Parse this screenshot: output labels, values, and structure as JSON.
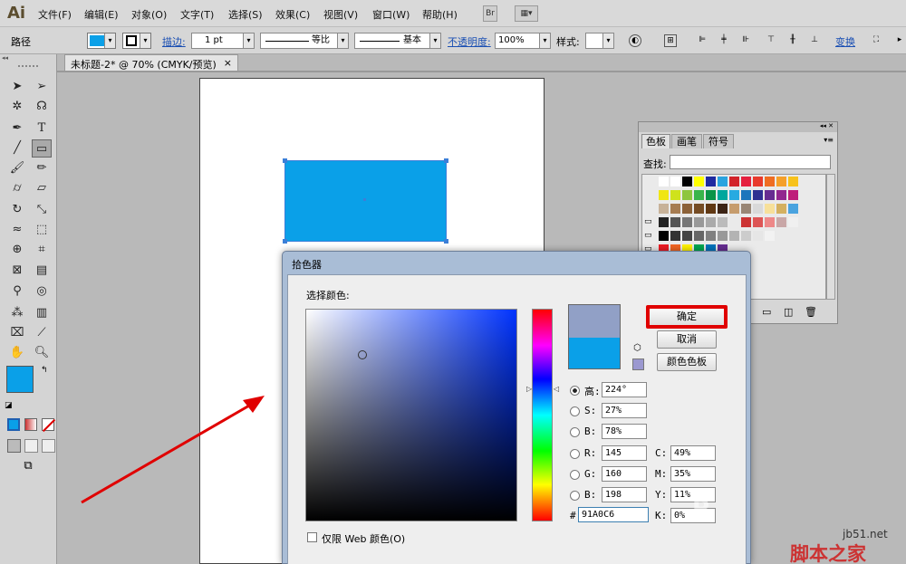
{
  "menubar": {
    "logo": "Ai",
    "items": [
      "文件(F)",
      "编辑(E)",
      "对象(O)",
      "文字(T)",
      "选择(S)",
      "效果(C)",
      "视图(V)",
      "窗口(W)",
      "帮助(H)"
    ],
    "bridge_label": "Br"
  },
  "control_bar": {
    "object_label": "路径",
    "stroke_link": "描边:",
    "stroke_weight": "1 pt",
    "profile_label": "等比",
    "brush_label": "基本",
    "opacity_link": "不透明度:",
    "opacity_value": "100%",
    "style_label": "样式:",
    "transform_link": "变换"
  },
  "document": {
    "tab_title": "未标题-2* @ 70% (CMYK/预览)",
    "close_glyph": "×"
  },
  "tools": {
    "fill_color": "#0aa0e8",
    "stroke_color": "#000000"
  },
  "swatches_panel": {
    "tabs": [
      "色板",
      "画笔",
      "符号"
    ],
    "search_label": "查找:",
    "search_value": ""
  },
  "color_picker": {
    "title": "拾色器",
    "select_label": "选择颜色:",
    "ok_label": "确定",
    "cancel_label": "取消",
    "swatches_label": "颜色色板",
    "h_label": "高:",
    "h_value": "224°",
    "s_label": "S:",
    "s_value": "27%",
    "b_label": "B:",
    "b_value": "78%",
    "r_label": "R:",
    "r_value": "145",
    "g_label": "G:",
    "g_value": "160",
    "b2_label": "B:",
    "b2_value": "198",
    "c_label": "C:",
    "c_value": "49%",
    "m_label": "M:",
    "m_value": "35%",
    "y_label": "Y:",
    "y_value": "11%",
    "k_label": "K:",
    "k_value": "0%",
    "hex_label": "#",
    "hex_value": "91A0C6",
    "web_only_label": "仅限 Web 颜色(O)",
    "new_color": "#91a0c6",
    "current_color": "#0aa0e8",
    "hue_color": "#0033ff"
  },
  "watermark": {
    "site": "jb51.net",
    "brand": "脚本之家"
  }
}
